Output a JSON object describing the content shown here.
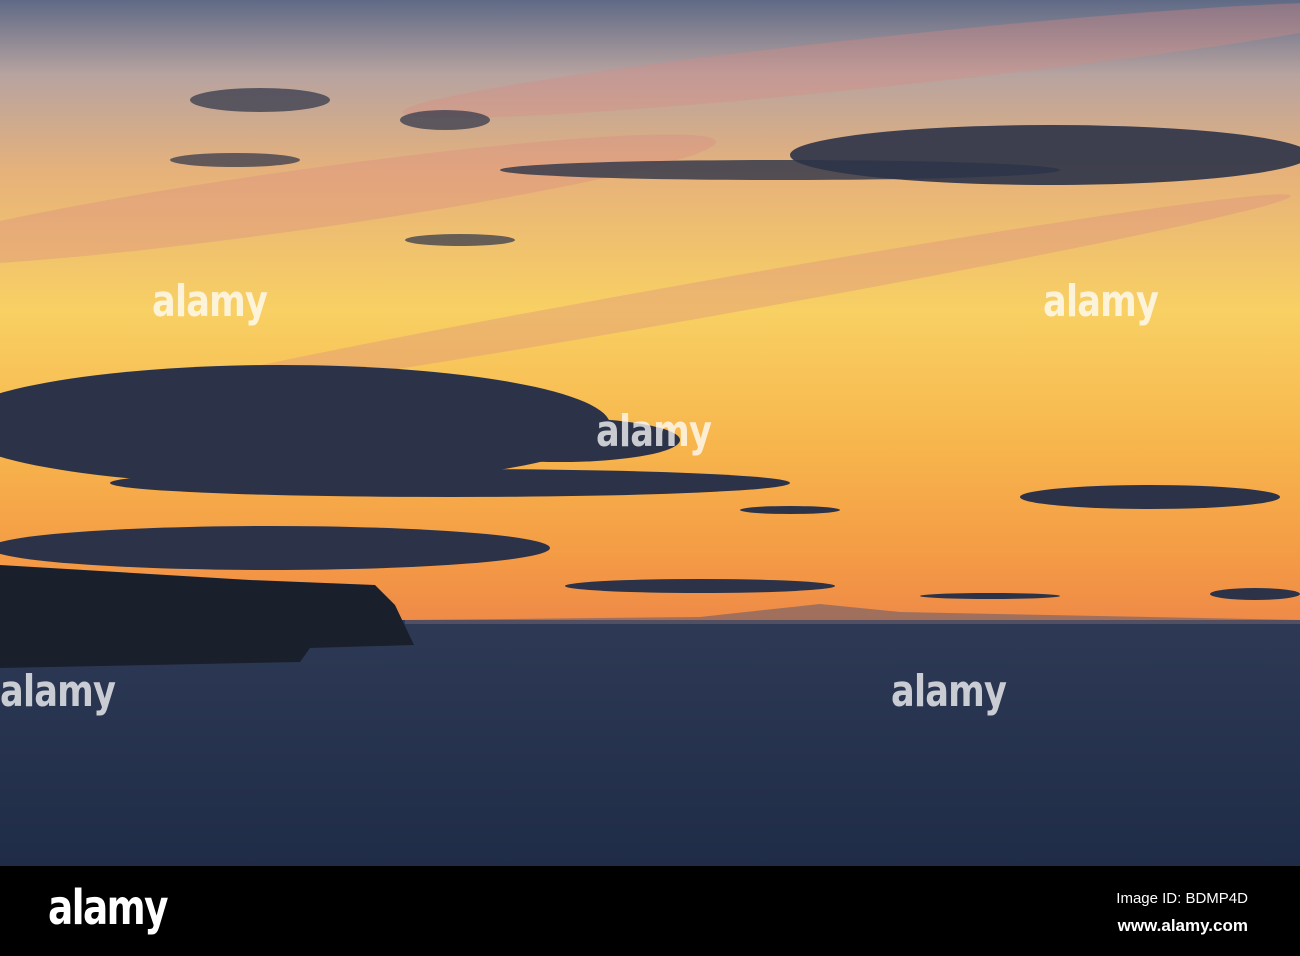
{
  "watermark": {
    "brand": "alamy"
  },
  "footer": {
    "logo": "alamy",
    "image_id": "Image ID: BDMP4D",
    "url": "www.alamy.com"
  },
  "colors": {
    "sky_top": "#5f6a86",
    "sky_mid": "#f6c35a",
    "horizon": "#f08a3a",
    "sea": "#26344f",
    "cloud": "#2c3348"
  }
}
